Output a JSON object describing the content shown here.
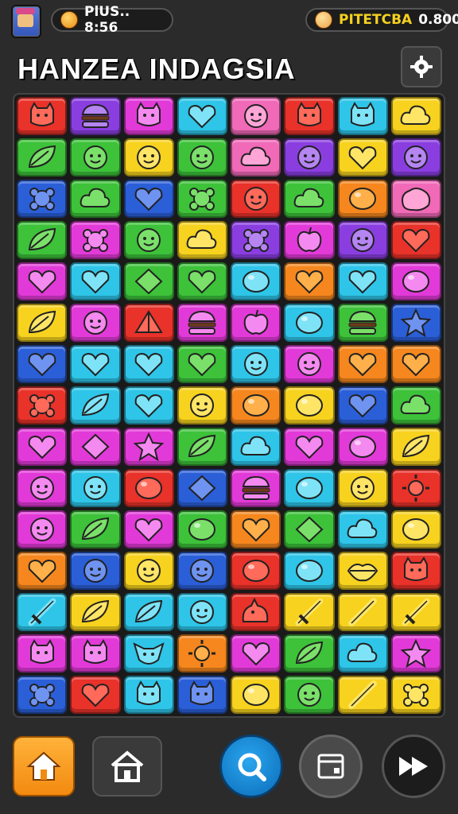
{
  "header": {
    "left_counter": "PlUS.. 8:56",
    "right_label": "PITETCBA",
    "right_value": "0.800"
  },
  "title": "HANZEA INDAGSIA",
  "icons": {
    "avatar": "player-avatar",
    "left_coin": "coin-icon",
    "right_coin": "face-coin-icon",
    "settings": "settings-gear-icon",
    "nav": [
      "home-icon",
      "shop-house-icon",
      "search-icon",
      "calendar-icon",
      "fast-forward-icon"
    ]
  },
  "colors": {
    "background": "#2b2b2b",
    "gold": "#f5d020",
    "home_button": "#f59a1a",
    "search_button": "#1487d6"
  },
  "board": {
    "columns": 8,
    "rows": 15,
    "tiles": [
      [
        "red-cat",
        "purple-burger",
        "magenta-cat",
        "cyan-heart",
        "pink-face",
        "red-cat",
        "cyan-cat",
        "yellow-cloud"
      ],
      [
        "green-leaf",
        "green-face",
        "yellow-face",
        "green-face",
        "pink-cloud",
        "purple-face",
        "yellow-heart",
        "purple-face"
      ],
      [
        "blue-flower",
        "green-cloud",
        "blue-heart",
        "green-flower",
        "red-face",
        "green-cloud",
        "orange-drop",
        "pink-blob"
      ],
      [
        "green-leaf",
        "magenta-flower",
        "green-face",
        "yellow-cloud",
        "purple-flower",
        "magenta-apple",
        "purple-face",
        "red-heart"
      ],
      [
        "magenta-heart",
        "cyan-heart",
        "green-diamond",
        "green-heart",
        "cyan-drop",
        "orange-heart",
        "cyan-heart",
        "magenta-drop"
      ],
      [
        "yellow-leaf",
        "magenta-face",
        "red-fan",
        "magenta-burger",
        "magenta-apple",
        "cyan-drop",
        "green-burger",
        "blue-star"
      ],
      [
        "blue-heart",
        "cyan-heart",
        "cyan-heart",
        "green-heart",
        "cyan-face",
        "magenta-face",
        "orange-heart",
        "orange-heart"
      ],
      [
        "red-flower",
        "cyan-leaf",
        "cyan-heart",
        "yellow-face",
        "orange-drop",
        "yellow-drop",
        "blue-heart",
        "green-cloud"
      ],
      [
        "magenta-heart",
        "magenta-diamond",
        "magenta-star",
        "green-leaf",
        "cyan-cloud",
        "magenta-heart",
        "magenta-drop",
        "yellow-leaf"
      ],
      [
        "magenta-face",
        "cyan-face",
        "red-drop",
        "blue-diamond",
        "magenta-burger",
        "cyan-drop",
        "yellow-face",
        "red-sun"
      ],
      [
        "magenta-face",
        "green-leaf",
        "magenta-heart",
        "green-drop",
        "orange-heart",
        "green-diamond",
        "cyan-cloud",
        "yellow-drop"
      ],
      [
        "orange-heart",
        "blue-face",
        "yellow-face",
        "blue-face",
        "red-drop",
        "cyan-drop",
        "yellow-lips",
        "red-cat"
      ],
      [
        "cyan-sword",
        "yellow-leaf",
        "cyan-leaf",
        "cyan-face",
        "red-dragon",
        "yellow-sword",
        "yellow-pencil",
        "yellow-sword"
      ],
      [
        "magenta-cat",
        "magenta-cat",
        "cyan-fox",
        "orange-sun",
        "magenta-heart",
        "green-leaf",
        "cyan-cloud",
        "magenta-star"
      ],
      [
        "blue-flower",
        "red-heart",
        "cyan-cat",
        "blue-cat",
        "yellow-drop",
        "green-face",
        "yellow-pencil",
        "yellow-flower"
      ]
    ]
  }
}
